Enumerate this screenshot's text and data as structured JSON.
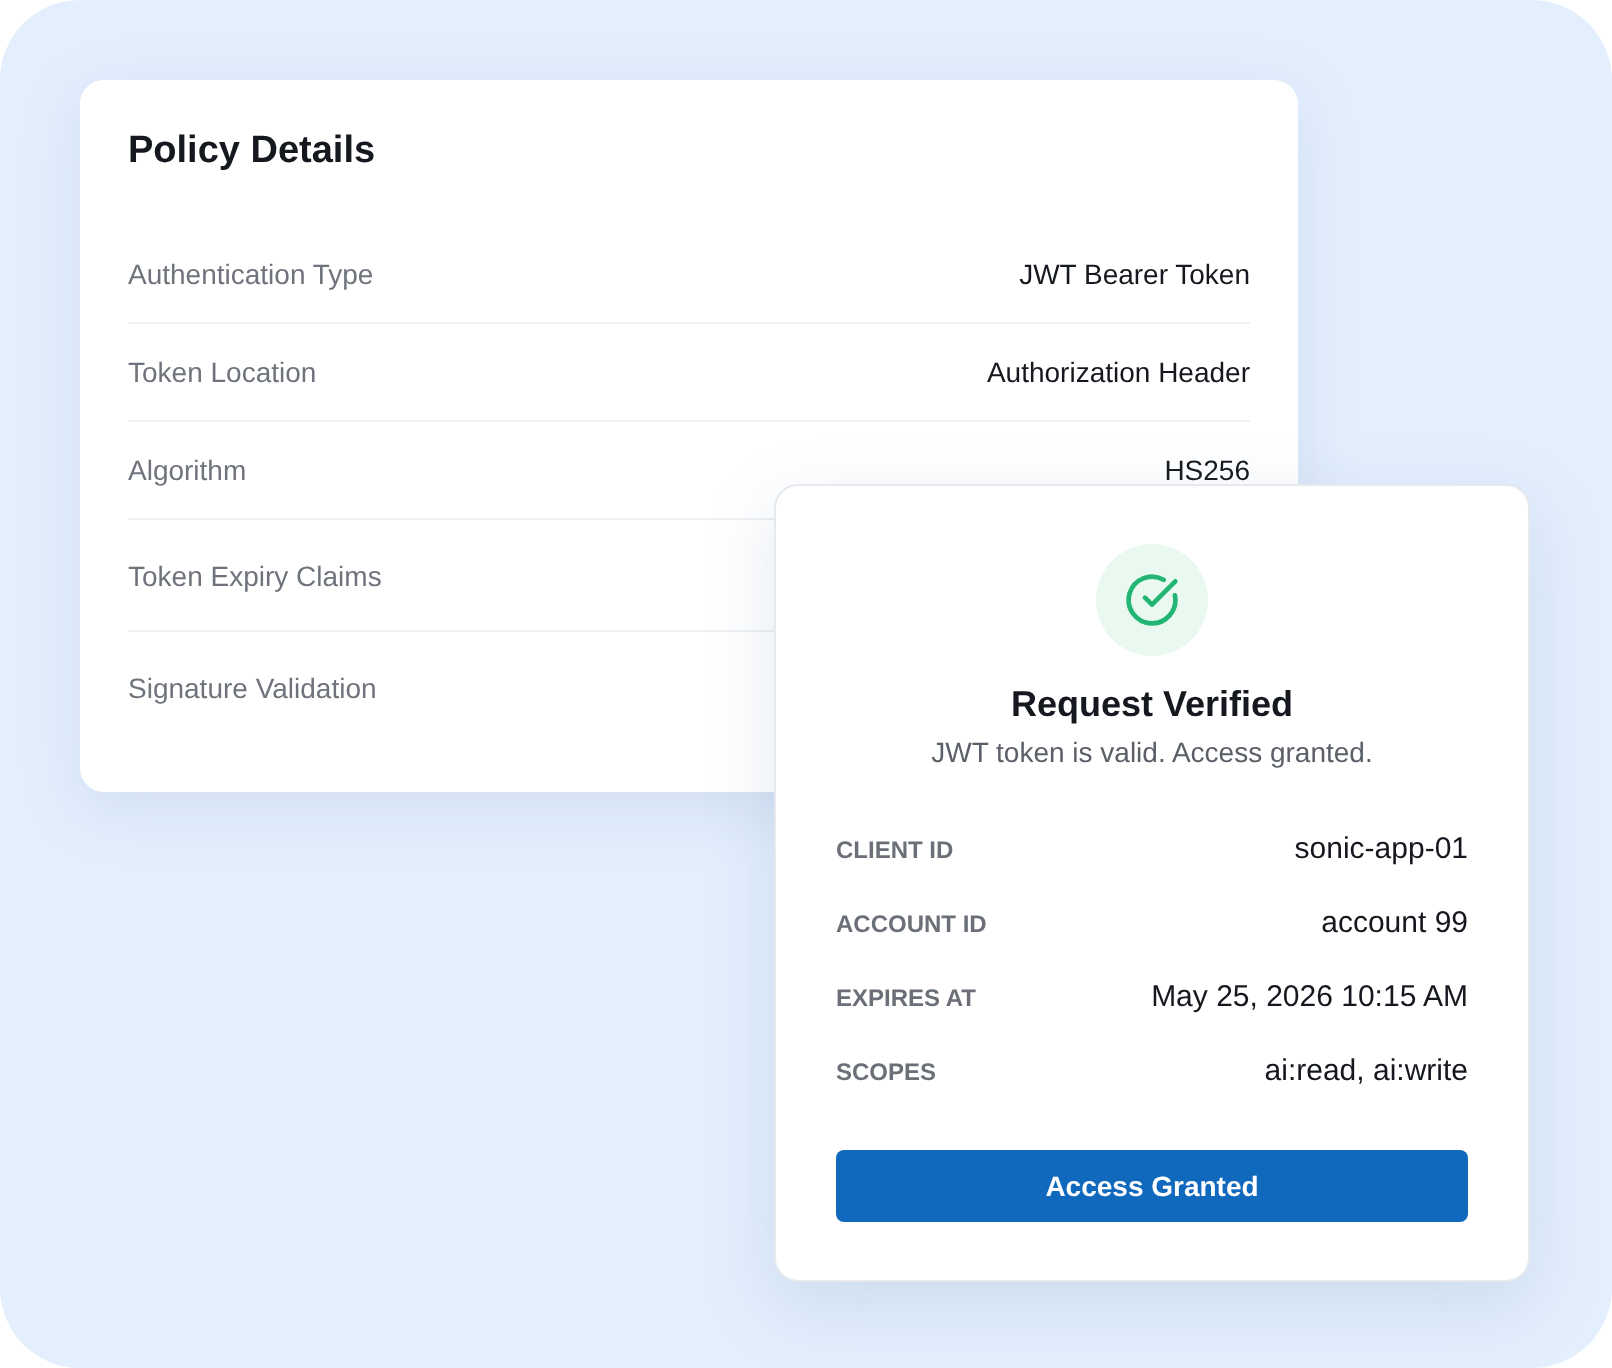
{
  "policy_card": {
    "title": "Policy Details",
    "rows": [
      {
        "label": "Authentication Type",
        "value": "JWT Bearer Token"
      },
      {
        "label": "Token Location",
        "value": "Authorization Header"
      },
      {
        "label": "Algorithm",
        "value": "HS256"
      },
      {
        "label": "Token Expiry Claims"
      },
      {
        "label": "Signature Validation"
      }
    ]
  },
  "verification_card": {
    "title": "Request Verified",
    "message": "JWT token is valid. Access granted.",
    "fields": [
      {
        "label": "CLIENT ID",
        "value": "sonic-app-01"
      },
      {
        "label": "ACCOUNT ID",
        "value": "account 99"
      },
      {
        "label": "EXPIRES AT",
        "value": "May 25, 2026 10:15 AM"
      },
      {
        "label": "SCOPES",
        "value": "ai:read, ai:write"
      }
    ],
    "button": "Access Granted"
  }
}
